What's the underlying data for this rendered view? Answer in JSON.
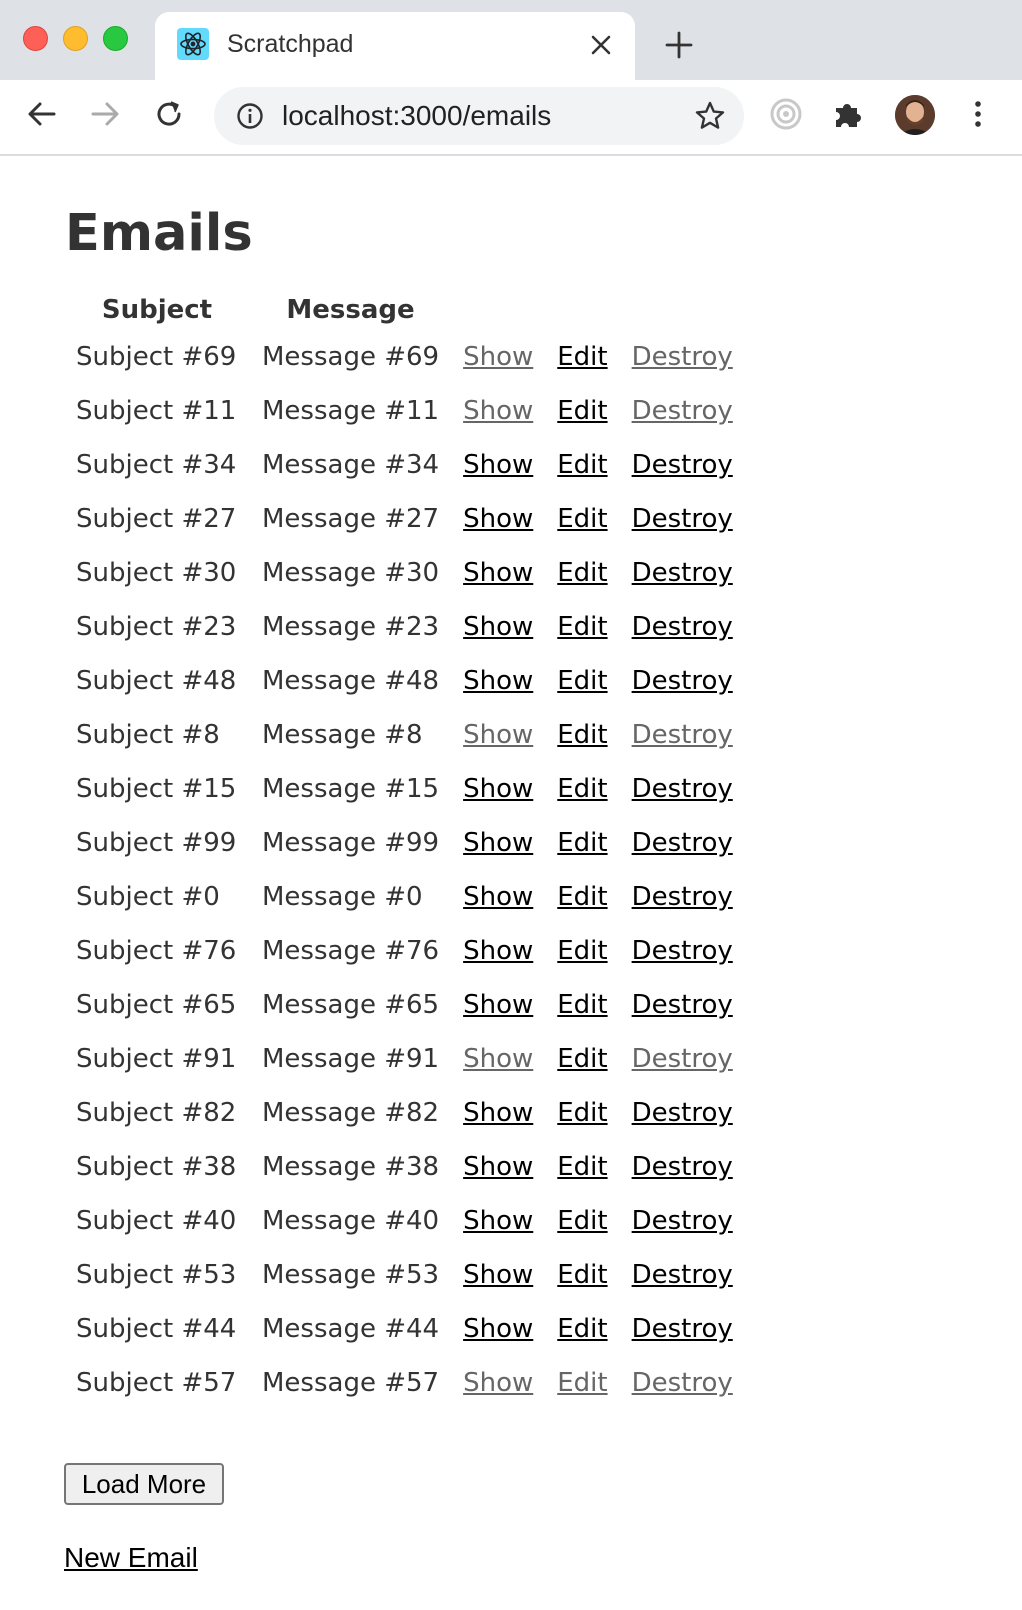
{
  "browser": {
    "tab": {
      "title": "Scratchpad",
      "favicon": "react-logo-icon"
    },
    "address_bar": {
      "url": "localhost:3000/emails"
    }
  },
  "page": {
    "title": "Emails",
    "table": {
      "headers": [
        "Subject",
        "Message"
      ],
      "rows": [
        {
          "subject": "Subject #69",
          "message": "Message #69",
          "show": "Show",
          "edit": "Edit",
          "destroy": "Destroy",
          "show_muted": true,
          "edit_muted": false,
          "destroy_muted": true
        },
        {
          "subject": "Subject #11",
          "message": "Message #11",
          "show": "Show",
          "edit": "Edit",
          "destroy": "Destroy",
          "show_muted": true,
          "edit_muted": false,
          "destroy_muted": true
        },
        {
          "subject": "Subject #34",
          "message": "Message #34",
          "show": "Show",
          "edit": "Edit",
          "destroy": "Destroy",
          "show_muted": false,
          "edit_muted": false,
          "destroy_muted": false
        },
        {
          "subject": "Subject #27",
          "message": "Message #27",
          "show": "Show",
          "edit": "Edit",
          "destroy": "Destroy",
          "show_muted": false,
          "edit_muted": false,
          "destroy_muted": false
        },
        {
          "subject": "Subject #30",
          "message": "Message #30",
          "show": "Show",
          "edit": "Edit",
          "destroy": "Destroy",
          "show_muted": false,
          "edit_muted": false,
          "destroy_muted": false
        },
        {
          "subject": "Subject #23",
          "message": "Message #23",
          "show": "Show",
          "edit": "Edit",
          "destroy": "Destroy",
          "show_muted": false,
          "edit_muted": false,
          "destroy_muted": false
        },
        {
          "subject": "Subject #48",
          "message": "Message #48",
          "show": "Show",
          "edit": "Edit",
          "destroy": "Destroy",
          "show_muted": false,
          "edit_muted": false,
          "destroy_muted": false
        },
        {
          "subject": "Subject #8",
          "message": "Message #8",
          "show": "Show",
          "edit": "Edit",
          "destroy": "Destroy",
          "show_muted": true,
          "edit_muted": false,
          "destroy_muted": true
        },
        {
          "subject": "Subject #15",
          "message": "Message #15",
          "show": "Show",
          "edit": "Edit",
          "destroy": "Destroy",
          "show_muted": false,
          "edit_muted": false,
          "destroy_muted": false
        },
        {
          "subject": "Subject #99",
          "message": "Message #99",
          "show": "Show",
          "edit": "Edit",
          "destroy": "Destroy",
          "show_muted": false,
          "edit_muted": false,
          "destroy_muted": false
        },
        {
          "subject": "Subject #0",
          "message": "Message #0",
          "show": "Show",
          "edit": "Edit",
          "destroy": "Destroy",
          "show_muted": false,
          "edit_muted": false,
          "destroy_muted": false
        },
        {
          "subject": "Subject #76",
          "message": "Message #76",
          "show": "Show",
          "edit": "Edit",
          "destroy": "Destroy",
          "show_muted": false,
          "edit_muted": false,
          "destroy_muted": false
        },
        {
          "subject": "Subject #65",
          "message": "Message #65",
          "show": "Show",
          "edit": "Edit",
          "destroy": "Destroy",
          "show_muted": false,
          "edit_muted": false,
          "destroy_muted": false
        },
        {
          "subject": "Subject #91",
          "message": "Message #91",
          "show": "Show",
          "edit": "Edit",
          "destroy": "Destroy",
          "show_muted": true,
          "edit_muted": false,
          "destroy_muted": true
        },
        {
          "subject": "Subject #82",
          "message": "Message #82",
          "show": "Show",
          "edit": "Edit",
          "destroy": "Destroy",
          "show_muted": false,
          "edit_muted": false,
          "destroy_muted": false
        },
        {
          "subject": "Subject #38",
          "message": "Message #38",
          "show": "Show",
          "edit": "Edit",
          "destroy": "Destroy",
          "show_muted": false,
          "edit_muted": false,
          "destroy_muted": false
        },
        {
          "subject": "Subject #40",
          "message": "Message #40",
          "show": "Show",
          "edit": "Edit",
          "destroy": "Destroy",
          "show_muted": false,
          "edit_muted": false,
          "destroy_muted": false
        },
        {
          "subject": "Subject #53",
          "message": "Message #53",
          "show": "Show",
          "edit": "Edit",
          "destroy": "Destroy",
          "show_muted": false,
          "edit_muted": false,
          "destroy_muted": false
        },
        {
          "subject": "Subject #44",
          "message": "Message #44",
          "show": "Show",
          "edit": "Edit",
          "destroy": "Destroy",
          "show_muted": false,
          "edit_muted": false,
          "destroy_muted": false
        },
        {
          "subject": "Subject #57",
          "message": "Message #57",
          "show": "Show",
          "edit": "Edit",
          "destroy": "Destroy",
          "show_muted": true,
          "edit_muted": true,
          "destroy_muted": true
        }
      ]
    },
    "load_more_label": "Load More",
    "new_email_label": "New Email"
  },
  "colors": {
    "link": "#000000",
    "link_muted": "#666666",
    "text": "#333333",
    "react_blue": "#61dafb"
  }
}
